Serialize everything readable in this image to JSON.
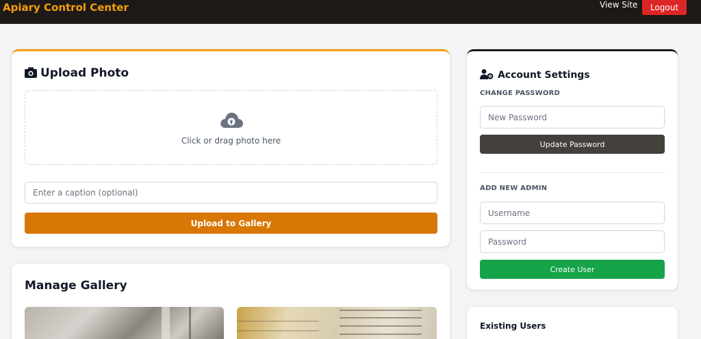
{
  "header": {
    "brand": "Apiary Control Center",
    "view_site": "View Site",
    "logout": "Logout",
    "brand_color": "#f59e0b",
    "logout_color": "#dc2626"
  },
  "upload": {
    "title": "Upload Photo",
    "icon": "camera-icon",
    "dropzone_icon": "cloud-upload-icon",
    "dropzone_text": "Click or drag photo here",
    "caption_placeholder": "Enter a caption (optional)",
    "button": "Upload to Gallery",
    "button_color": "#d97706"
  },
  "gallery": {
    "title": "Manage Gallery",
    "photos": [
      "gallery-photo-1",
      "gallery-photo-2"
    ]
  },
  "account": {
    "title": "Account Settings",
    "icon": "user-gear-icon",
    "change_password": {
      "label": "CHANGE PASSWORD",
      "new_password_placeholder": "New Password",
      "button": "Update Password"
    },
    "add_admin": {
      "label": "ADD NEW ADMIN",
      "username_placeholder": "Username",
      "password_placeholder": "Password",
      "button": "Create User",
      "button_color": "#16a34a"
    }
  },
  "users": {
    "title": "Existing Users"
  }
}
